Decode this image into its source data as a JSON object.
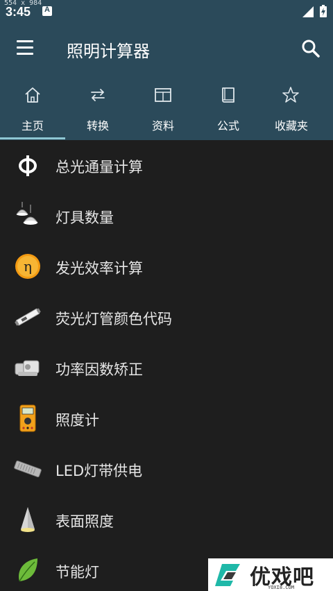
{
  "status_bar": {
    "dims_overlay": "554 x 984",
    "time": "3:45"
  },
  "app_bar": {
    "title": "照明计算器"
  },
  "tabs": [
    {
      "label": "主页",
      "icon": "home-icon",
      "active": true
    },
    {
      "label": "转换",
      "icon": "swap-arrows-icon",
      "active": false
    },
    {
      "label": "资料",
      "icon": "table-icon",
      "active": false
    },
    {
      "label": "公式",
      "icon": "book-icon",
      "active": false
    },
    {
      "label": "收藏夹",
      "icon": "star-icon",
      "active": false
    }
  ],
  "items": [
    {
      "label": "总光通量计算",
      "icon": "phi-symbol-icon"
    },
    {
      "label": "灯具数量",
      "icon": "pendant-lamps-icon"
    },
    {
      "label": "发光效率计算",
      "icon": "eta-orange-circle-icon"
    },
    {
      "label": "荧光灯管颜色代码",
      "icon": "fluorescent-tube-icon"
    },
    {
      "label": "功率因数矫正",
      "icon": "capacitor-icon"
    },
    {
      "label": "照度计",
      "icon": "lux-meter-icon"
    },
    {
      "label": "LED灯带供电",
      "icon": "led-power-supply-icon"
    },
    {
      "label": "表面照度",
      "icon": "light-cone-icon"
    },
    {
      "label": "节能灯",
      "icon": "green-leaf-icon"
    }
  ],
  "watermark": {
    "text": "优戏吧",
    "sub": "YOXI8.COM"
  },
  "colors": {
    "primary": "#2b4a5a",
    "background": "#1e1e1e",
    "indicator": "#8ec6d3",
    "text": "#e6e6e6"
  }
}
